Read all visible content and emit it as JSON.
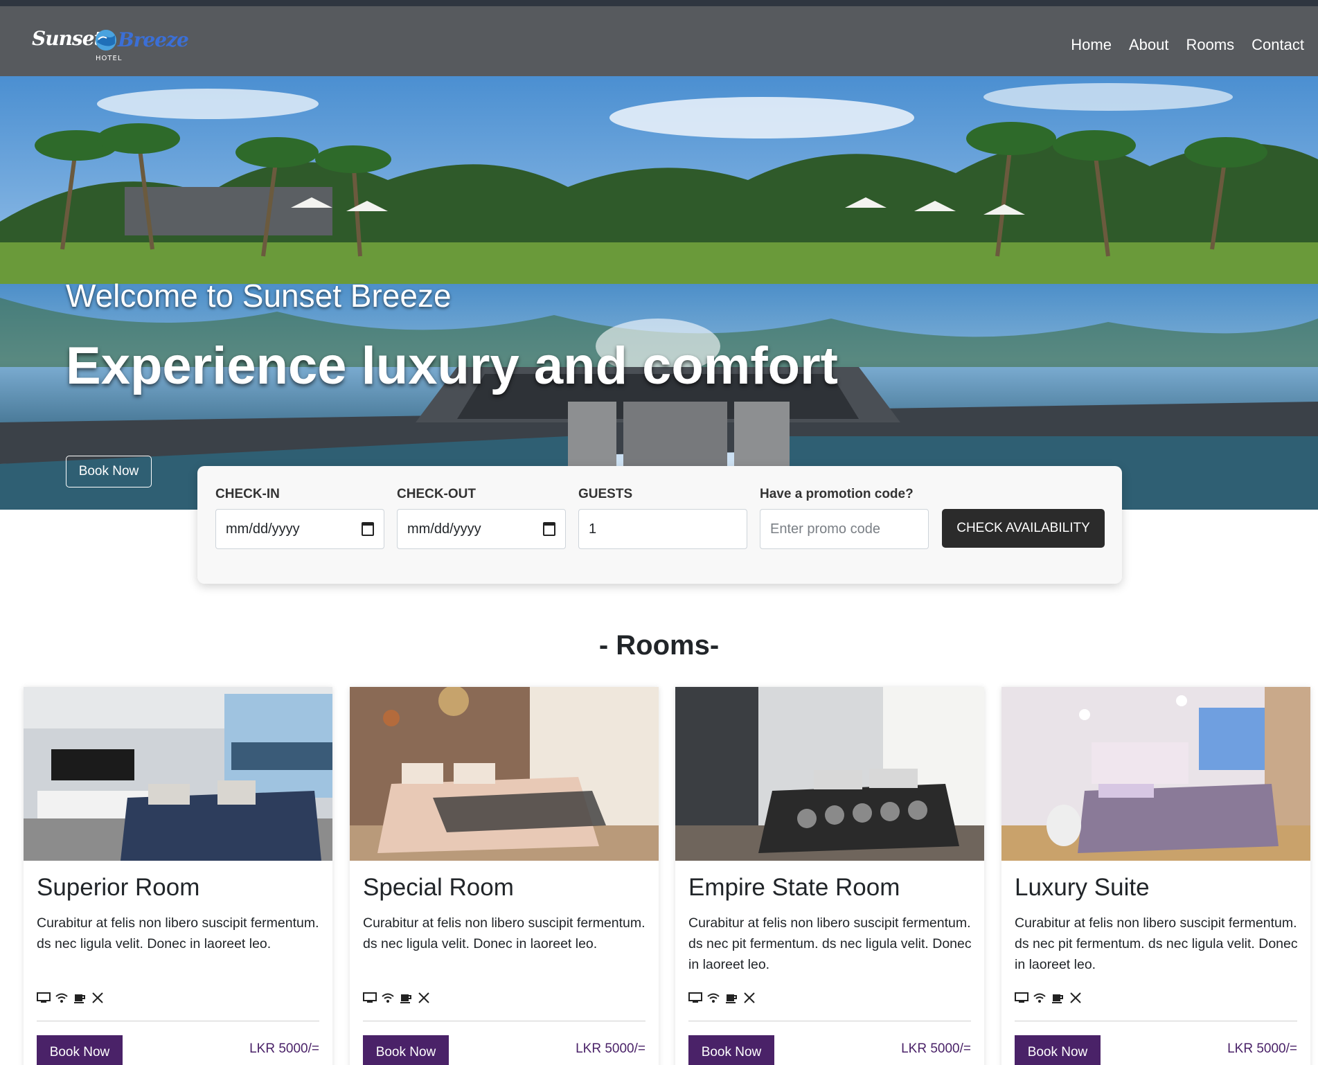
{
  "brand": {
    "name_part1": "Sunset",
    "name_part2": "Breeze",
    "tagline": "HOTEL"
  },
  "nav": [
    {
      "label": "Home"
    },
    {
      "label": "About"
    },
    {
      "label": "Rooms"
    },
    {
      "label": "Contact"
    }
  ],
  "hero": {
    "subtitle": "Welcome to Sunset Breeze",
    "title": "Experience luxury and comfort",
    "button": "Book Now"
  },
  "booking": {
    "checkin_label": "CHECK-IN",
    "checkin_value": "mm/dd/yyyy",
    "checkout_label": "CHECK-OUT",
    "checkout_value": "mm/dd/yyyy",
    "guests_label": "GUESTS",
    "guests_value": "1",
    "promo_label": "Have a promotion code?",
    "promo_placeholder": "Enter promo code",
    "button": "CHECK AVAILABILITY"
  },
  "rooms": {
    "title": "- Rooms-",
    "items": [
      {
        "name": "Superior Room",
        "description": "Curabitur at felis non libero suscipit fermentum. ds nec ligula velit. Donec in laoreet leo.",
        "button": "Book Now",
        "price": "LKR 5000/="
      },
      {
        "name": "Special Room",
        "description": "Curabitur at felis non libero suscipit fermentum. ds nec ligula velit. Donec in laoreet leo.",
        "button": "Book Now",
        "price": "LKR 5000/="
      },
      {
        "name": "Empire State Room",
        "description": "Curabitur at felis non libero suscipit fermentum. ds nec pit fermentum. ds nec ligula velit. Donec in laoreet leo.",
        "button": "Book Now",
        "price": "LKR 5000/="
      },
      {
        "name": "Luxury Suite",
        "description": "Curabitur at felis non libero suscipit fermentum. ds nec pit fermentum. ds nec ligula velit. Donec in laoreet leo.",
        "button": "Book Now",
        "price": "LKR 5000/="
      }
    ],
    "amenity_icons": [
      "tv-icon",
      "wifi-icon",
      "coffee-icon",
      "dining-icon"
    ]
  },
  "colors": {
    "navbar": "#575a5e",
    "accent": "#4a2268",
    "brand_blue": "#3b6fd6",
    "dark_button": "#2b2b2b"
  }
}
